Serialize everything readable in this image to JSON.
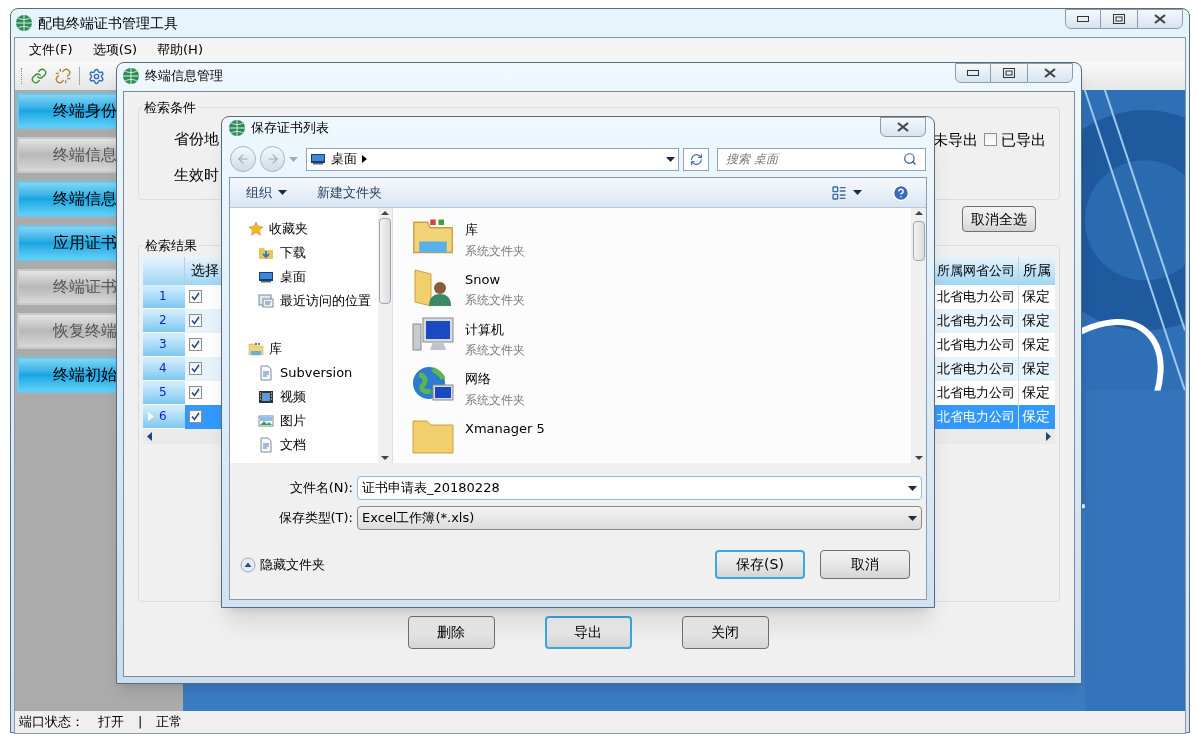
{
  "main_window": {
    "title": "配电终端证书管理工具",
    "menu": [
      "文件(F)",
      "选项(S)",
      "帮助(H)"
    ],
    "sidebar": [
      {
        "label": "终端身份",
        "disabled": false
      },
      {
        "label": "终端信息",
        "disabled": true
      },
      {
        "label": "终端信息",
        "disabled": false
      },
      {
        "label": "应用证书",
        "disabled": false
      },
      {
        "label": "终端证书",
        "disabled": true
      },
      {
        "label": "恢复终端",
        "disabled": true
      },
      {
        "label": "终端初始",
        "disabled": false
      }
    ],
    "status_bar": {
      "label": "端口状态：",
      "port": "打开",
      "separator": "|",
      "state": "正常"
    }
  },
  "terminal_window": {
    "title": "终端信息管理",
    "search_group": {
      "title": "检索条件",
      "fields": [
        "省份地",
        "生效时"
      ],
      "export_filters": [
        {
          "label": "未导出"
        },
        {
          "label": "已导出",
          "checked": false
        }
      ]
    },
    "deselect_all_button": "取消全选",
    "results": {
      "title": "检索结果",
      "columns": [
        "选择",
        "所属网省公司",
        "所属"
      ],
      "rows": [
        {
          "number": "1",
          "checked": true,
          "selected": false,
          "company": "北省电力公司",
          "column_4": "保定"
        },
        {
          "number": "2",
          "checked": true,
          "selected": false,
          "company": "北省电力公司",
          "column_4": "保定"
        },
        {
          "number": "3",
          "checked": true,
          "selected": false,
          "company": "北省电力公司",
          "column_4": "保定"
        },
        {
          "number": "4",
          "checked": true,
          "selected": false,
          "company": "北省电力公司",
          "column_4": "保定"
        },
        {
          "number": "5",
          "checked": true,
          "selected": false,
          "company": "北省电力公司",
          "column_4": "保定"
        },
        {
          "number": "6",
          "checked": true,
          "selected": true,
          "company": "北省电力公司",
          "column_4": "保定"
        }
      ]
    },
    "buttons": [
      {
        "label": "删除",
        "default": false
      },
      {
        "label": "导出",
        "default": true
      },
      {
        "label": "关闭",
        "default": false
      }
    ]
  },
  "save_dialog": {
    "title": "保存证书列表",
    "address": "桌面",
    "search_placeholder": "搜索 桌面",
    "toolbar": {
      "organize": "组织",
      "new_folder": "新建文件夹"
    },
    "nav": [
      {
        "label": "收藏夹",
        "kind": "star",
        "children": [
          {
            "label": "下载",
            "kind": "download"
          },
          {
            "label": "桌面",
            "kind": "desktop"
          },
          {
            "label": "最近访问的位置",
            "kind": "recent"
          }
        ]
      },
      {
        "label": "库",
        "kind": "library",
        "children": [
          {
            "label": "Subversion",
            "kind": "document"
          },
          {
            "label": "视频",
            "kind": "video"
          },
          {
            "label": "图片",
            "kind": "picture"
          },
          {
            "label": "文档",
            "kind": "document"
          }
        ]
      }
    ],
    "files": [
      {
        "name": "库",
        "type": "系统文件夹",
        "kind": "library"
      },
      {
        "name": "Snow",
        "type": "系统文件夹",
        "kind": "user"
      },
      {
        "name": "计算机",
        "type": "系统文件夹",
        "kind": "computer"
      },
      {
        "name": "网络",
        "type": "系统文件夹",
        "kind": "network"
      },
      {
        "name": "Xmanager 5",
        "kind": "folder"
      }
    ],
    "file_name": {
      "label": "文件名(N):",
      "value": "证书申请表_20180228"
    },
    "file_type": {
      "label": "保存类型(T):",
      "value": "Excel工作簿(*.xls)"
    },
    "hide_folders": "隐藏文件夹",
    "buttons": [
      {
        "label": "保存(S)",
        "default": true
      },
      {
        "label": "取消",
        "default": false
      }
    ]
  }
}
